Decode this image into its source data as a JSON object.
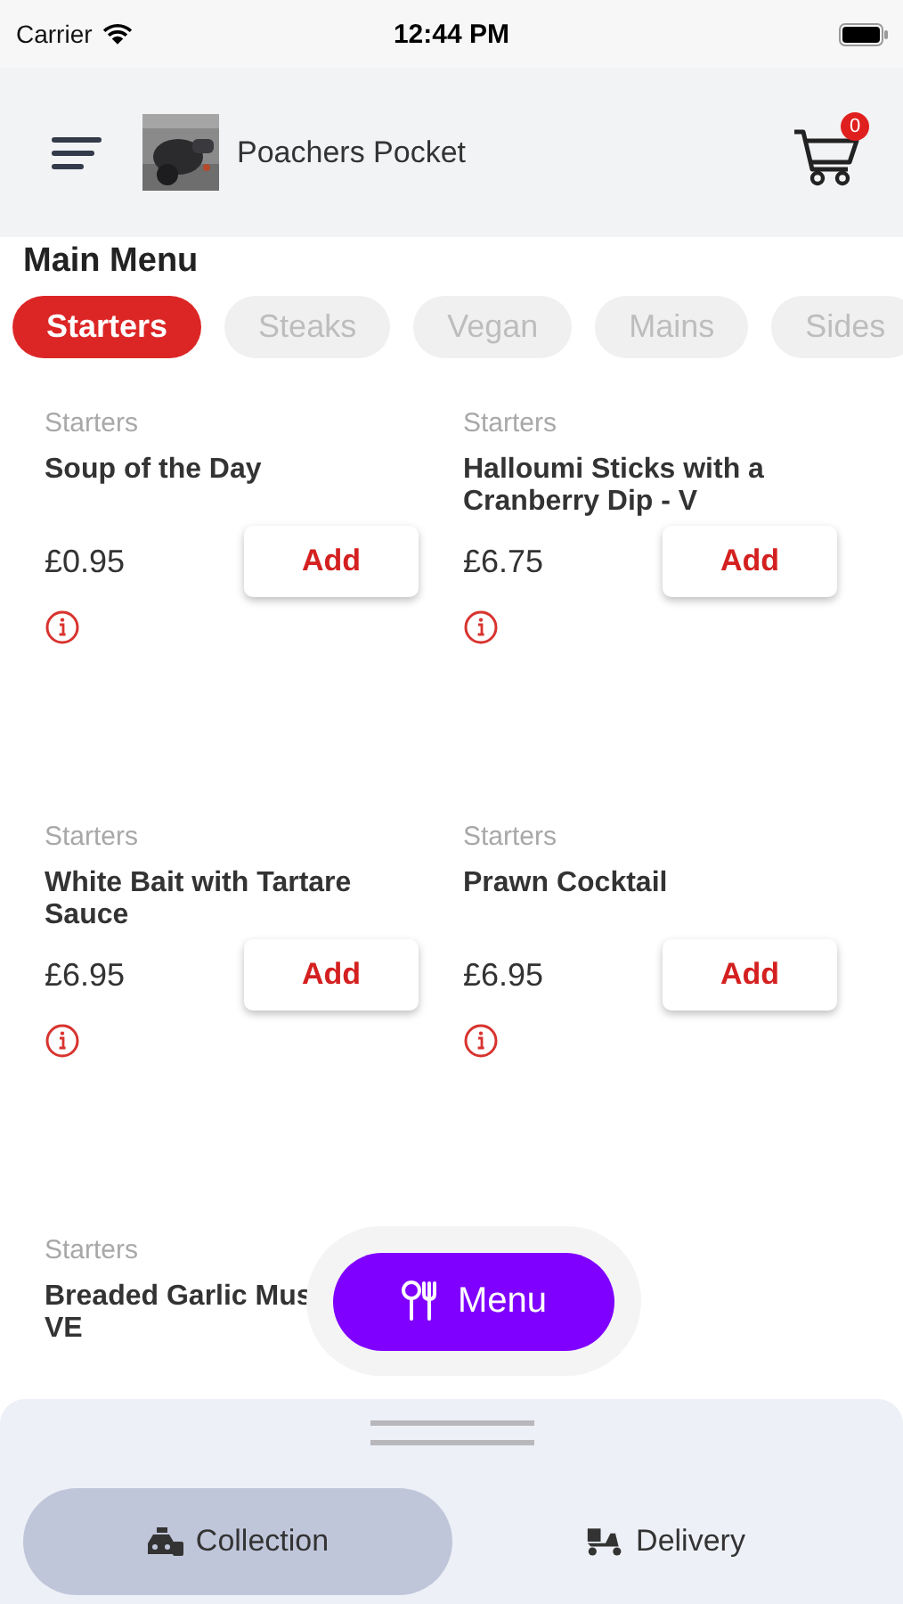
{
  "status_bar": {
    "carrier": "Carrier",
    "time": "12:44 PM"
  },
  "header": {
    "title": "Poachers Pocket",
    "cart_count": "0"
  },
  "menu_title": "Main Menu",
  "categories": [
    {
      "label": "Starters",
      "selected": true
    },
    {
      "label": "Steaks",
      "selected": false
    },
    {
      "label": "Vegan",
      "selected": false
    },
    {
      "label": "Mains",
      "selected": false
    },
    {
      "label": "Sides",
      "selected": false
    }
  ],
  "items": [
    {
      "category": "Starters",
      "name": "Soup of the Day",
      "price": "£0.95",
      "button": "Add"
    },
    {
      "category": "Starters",
      "name": "Halloumi Sticks with a Cranberry Dip - V",
      "price": "£6.75",
      "button": "Add"
    },
    {
      "category": "Starters",
      "name": "White Bait with Tartare Sauce",
      "price": "£6.95",
      "button": "Add"
    },
    {
      "category": "Starters",
      "name": "Prawn Cocktail",
      "price": "£6.95",
      "button": "Add"
    },
    {
      "category": "Starters",
      "name": "Breaded Garlic Mus\nVE"
    }
  ],
  "fab": {
    "label": "Menu"
  },
  "order_types": [
    {
      "label": "Collection",
      "kind": "collection",
      "selected": true
    },
    {
      "label": "Delivery",
      "kind": "delivery",
      "selected": false
    }
  ]
}
